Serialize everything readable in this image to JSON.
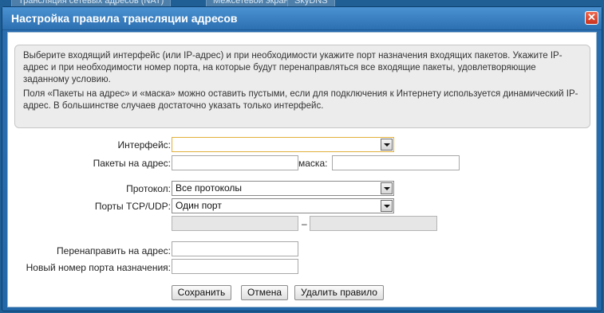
{
  "background_tabs": [
    "Трансляция сетевых адресов (NAT)",
    "Межсетевой экран",
    "SkyDNS"
  ],
  "dialog": {
    "title": "Настройка правила трансляции адресов",
    "close_label": "✕"
  },
  "info": {
    "paragraph1": "Выберите входящий интерфейс (или IP-адрес) и при необходимости укажите порт назначения входящих пакетов. Укажите IP-адрес и при необходимости номер порта, на которые будут перенаправляться все входящие пакеты, удовлетворяющие заданному условию.",
    "paragraph2": "Поля «Пакеты на адрес» и «маска» можно оставить пустыми, если для подключения к Интернету используется динамический IP-адрес. В большинстве случаев достаточно указать только интерфейс."
  },
  "form": {
    "interface_label": "Интерфейс:",
    "interface_value": "",
    "packets_to_address_label": "Пакеты на адрес:",
    "packets_to_address_value": "",
    "mask_label": "маска:",
    "mask_value": "",
    "protocol_label": "Протокол:",
    "protocol_value": "Все протоколы",
    "ports_label": "Порты TCP/UDP:",
    "ports_value": "Один порт",
    "port_from_value": "",
    "port_dash": "–",
    "port_to_value": "",
    "redirect_address_label": "Перенаправить на адрес:",
    "redirect_address_value": "",
    "new_port_label": "Новый номер порта назначения:",
    "new_port_value": ""
  },
  "buttons": {
    "save": "Сохранить",
    "cancel": "Отмена",
    "delete_rule": "Удалить правило"
  },
  "colors": {
    "titlebar": "#3a82c4",
    "close_button": "#d9442c",
    "focus_border": "#e2b03a"
  }
}
